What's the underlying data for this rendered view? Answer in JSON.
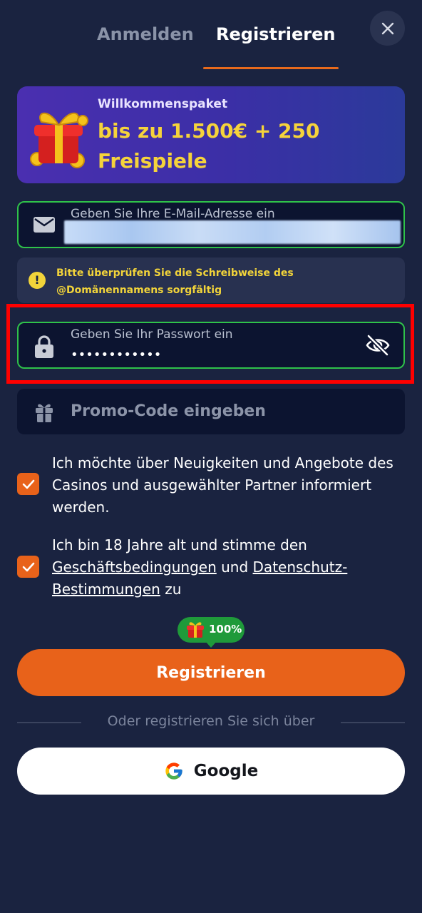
{
  "tabs": {
    "login": "Anmelden",
    "register": "Registrieren"
  },
  "banner": {
    "subtitle": "Willkommenspaket",
    "headline": "bis zu 1.500€ + 250 Freispiele"
  },
  "email": {
    "label": "Geben Sie Ihre E-Mail-Adresse ein"
  },
  "warning": {
    "text_line1": "Bitte überprüfen Sie die Schreibweise des",
    "text_line2": "@Domänennamens sorgfältig"
  },
  "password": {
    "label": "Geben Sie Ihr Passwort ein",
    "value": "••••••••••••"
  },
  "promo": {
    "placeholder": "Promo-Code eingeben"
  },
  "consent1": {
    "text": "Ich möchte über Neuigkeiten und Angebote des Casinos und ausgewählter Partner informiert werden."
  },
  "consent2": {
    "prefix": "Ich bin 18 Jahre alt und stimme den ",
    "link1": "Geschäftsbedingungen",
    "middle": " und ",
    "link2": "Datenschutz-Bestimmungen",
    "suffix": " zu"
  },
  "bonus": {
    "percent": "100%"
  },
  "register_button": "Registrieren",
  "divider": "Oder registrieren Sie sich über",
  "google_button": "Google",
  "colors": {
    "accent": "#e8621a",
    "background": "#1a2340",
    "success": "#2fc24a",
    "warning": "#f2d43a"
  }
}
